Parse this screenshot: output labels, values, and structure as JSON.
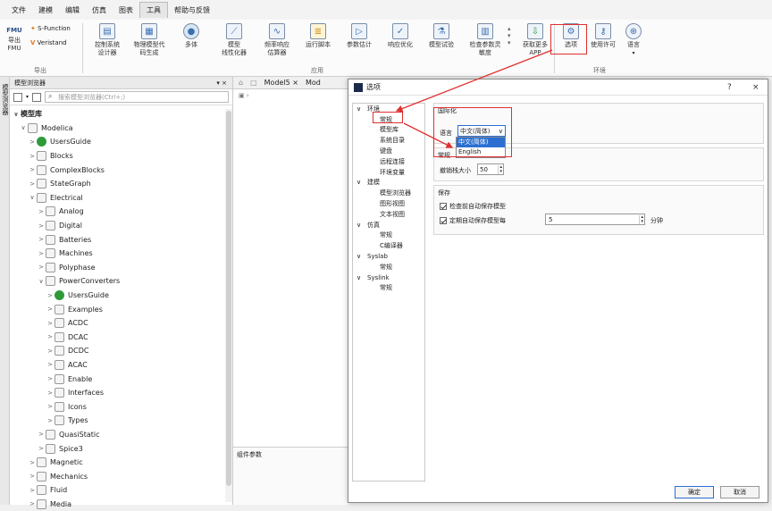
{
  "menu": [
    "文件",
    "建模",
    "编辑",
    "仿真",
    "图表",
    "工具",
    "帮助与反馈"
  ],
  "ribbon": {
    "fmu_label": "FMU",
    "export_fmu": "导出\nFMU",
    "sfunction": "S-Function",
    "veristand": "Veristand",
    "group_export": "导出",
    "group_apply": "应用",
    "group_env": "环境",
    "buttons": [
      "控制系统\n设计器",
      "物理模型代\n码生成",
      "多体",
      "模型\n线性化器",
      "频率响应\n估算器",
      "运行脚本",
      "参数估计",
      "响应优化",
      "模型试验",
      "检查参数灵\n敏度",
      "获取更多\nAPP",
      "选项",
      "使用许可",
      "语言"
    ]
  },
  "left_strip": "模型浏览器",
  "browser": {
    "title": "模型浏览器",
    "pin": "▾ ×",
    "search_placeholder": "搜索模型浏览器(Ctrl+;)",
    "root": "模型库",
    "rows": [
      {
        "d": 0,
        "a": "∨",
        "i": "lib",
        "t": "Modelica"
      },
      {
        "d": 1,
        "a": ">",
        "i": "green",
        "t": "UsersGuide"
      },
      {
        "d": 1,
        "a": ">",
        "i": "box",
        "t": "Blocks"
      },
      {
        "d": 1,
        "a": ">",
        "i": "box",
        "t": "ComplexBlocks"
      },
      {
        "d": 1,
        "a": ">",
        "i": "box",
        "t": "StateGraph"
      },
      {
        "d": 1,
        "a": "∨",
        "i": "box",
        "t": "Electrical"
      },
      {
        "d": 2,
        "a": ">",
        "i": "box",
        "t": "Analog"
      },
      {
        "d": 2,
        "a": ">",
        "i": "box",
        "t": "Digital"
      },
      {
        "d": 2,
        "a": ">",
        "i": "box",
        "t": "Batteries"
      },
      {
        "d": 2,
        "a": ">",
        "i": "box",
        "t": "Machines"
      },
      {
        "d": 2,
        "a": ">",
        "i": "box",
        "t": "Polyphase"
      },
      {
        "d": 2,
        "a": "∨",
        "i": "box",
        "t": "PowerConverters"
      },
      {
        "d": 3,
        "a": ">",
        "i": "green",
        "t": "UsersGuide"
      },
      {
        "d": 3,
        "a": ">",
        "i": "box",
        "t": "Examples"
      },
      {
        "d": 3,
        "a": ">",
        "i": "box",
        "t": "ACDC"
      },
      {
        "d": 3,
        "a": ">",
        "i": "box",
        "t": "DCAC"
      },
      {
        "d": 3,
        "a": ">",
        "i": "box",
        "t": "DCDC"
      },
      {
        "d": 3,
        "a": ">",
        "i": "box",
        "t": "ACAC"
      },
      {
        "d": 3,
        "a": ">",
        "i": "box",
        "t": "Enable"
      },
      {
        "d": 3,
        "a": ">",
        "i": "box",
        "t": "Interfaces"
      },
      {
        "d": 3,
        "a": ">",
        "i": "box",
        "t": "Icons"
      },
      {
        "d": 3,
        "a": ">",
        "i": "box",
        "t": "Types"
      },
      {
        "d": 2,
        "a": ">",
        "i": "box",
        "t": "QuasiStatic"
      },
      {
        "d": 2,
        "a": ">",
        "i": "box",
        "t": "Spice3"
      },
      {
        "d": 1,
        "a": ">",
        "i": "box",
        "t": "Magnetic"
      },
      {
        "d": 1,
        "a": ">",
        "i": "box",
        "t": "Mechanics"
      },
      {
        "d": 1,
        "a": ">",
        "i": "box",
        "t": "Fluid"
      },
      {
        "d": 1,
        "a": ">",
        "i": "box",
        "t": "Media"
      }
    ]
  },
  "editor": {
    "tab1": "Model5",
    "tab1_close": "×",
    "tab2": "Mod",
    "comp_params": "组件参数"
  },
  "dialog": {
    "title": "选项",
    "help": "?",
    "close": "×",
    "nav": [
      {
        "d": 0,
        "a": "∨",
        "t": "环境"
      },
      {
        "d": 1,
        "t": "常规"
      },
      {
        "d": 1,
        "t": "模型库"
      },
      {
        "d": 1,
        "t": "系统目录"
      },
      {
        "d": 1,
        "t": "键盘"
      },
      {
        "d": 1,
        "t": "远程连接"
      },
      {
        "d": 1,
        "t": "环境变量"
      },
      {
        "d": 0,
        "a": "∨",
        "t": "建模"
      },
      {
        "d": 1,
        "t": "模型浏览器"
      },
      {
        "d": 1,
        "t": "图形视图"
      },
      {
        "d": 1,
        "t": "文本视图"
      },
      {
        "d": 0,
        "a": "∨",
        "t": "仿真"
      },
      {
        "d": 1,
        "t": "常规"
      },
      {
        "d": 1,
        "t": "C编译器"
      },
      {
        "d": 0,
        "a": "∨",
        "t": "Syslab"
      },
      {
        "d": 1,
        "t": "常规"
      },
      {
        "d": 0,
        "a": "∨",
        "t": "Syslink"
      },
      {
        "d": 1,
        "t": "常规"
      }
    ],
    "intl_title": "国际化",
    "lang_label": "语言",
    "lang_value": "中文(简体)",
    "lang_options": [
      "中文(简体)",
      "English"
    ],
    "general_title": "常规",
    "undo_label": "撤销栈大小",
    "undo_value": "50",
    "save_title": "保存",
    "save_before_check": "检查前自动保存模型",
    "auto_save": "定期自动保存模型每",
    "auto_save_value": "5",
    "minutes": "分钟",
    "ok": "确定",
    "cancel": "取消"
  }
}
